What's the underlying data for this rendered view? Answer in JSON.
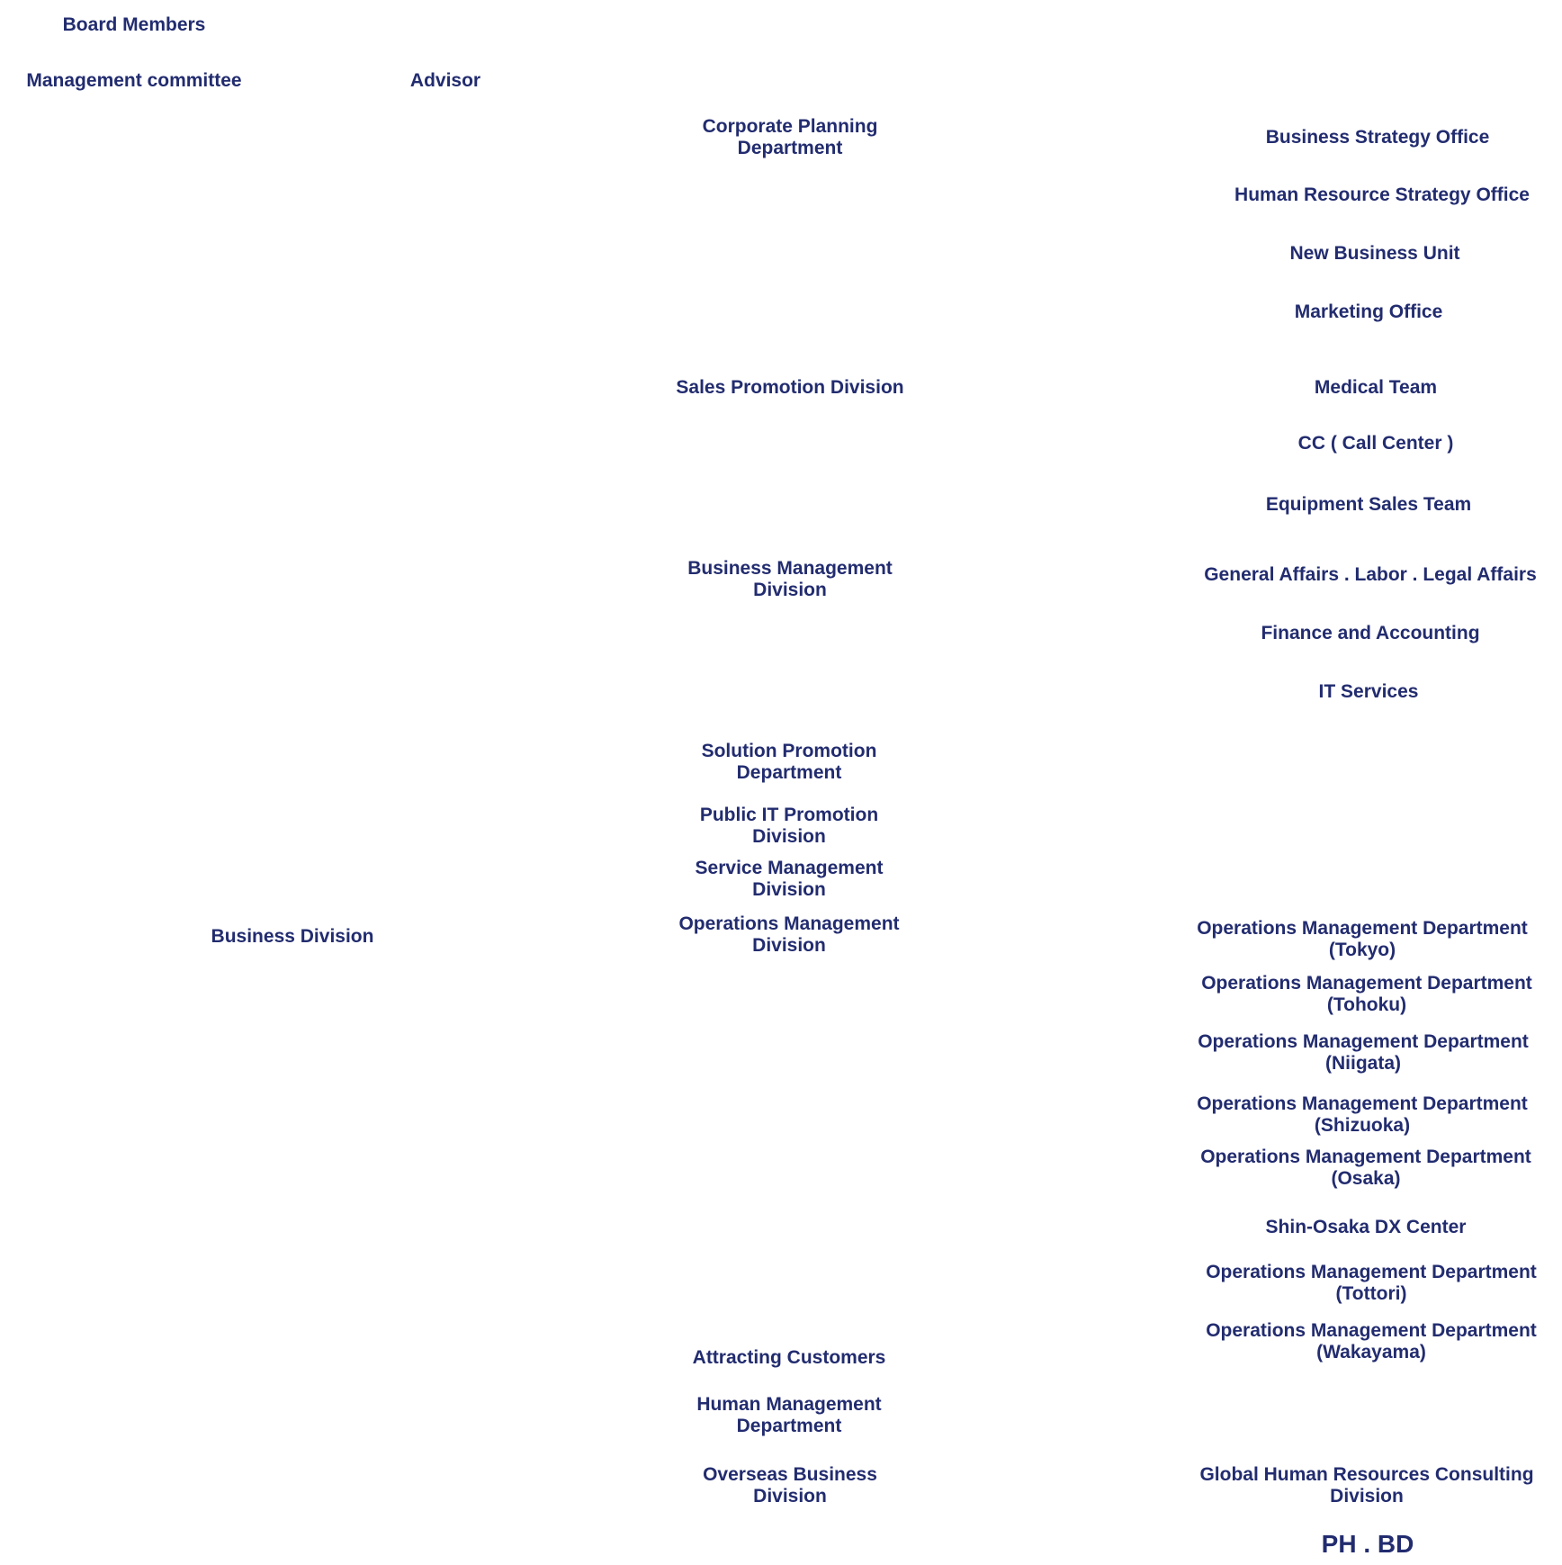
{
  "colors": {
    "text": "#222c6f",
    "background": "#ffffff"
  },
  "top": {
    "board_members": "Board Members",
    "management_committee": "Management committee",
    "advisor": "Advisor"
  },
  "business_division": "Business Division",
  "divisions": [
    {
      "label": "Corporate Planning\nDepartment"
    },
    {
      "label": "Sales Promotion Division"
    },
    {
      "label": "Business Management\nDivision"
    },
    {
      "label": "Solution Promotion\nDepartment"
    },
    {
      "label": "Public IT Promotion\nDivision"
    },
    {
      "label": "Service Management\nDivision"
    },
    {
      "label": "Operations Management\nDivision"
    },
    {
      "label": "Attracting Customers"
    },
    {
      "label": "Human Management\nDepartment"
    },
    {
      "label": "Overseas Business\nDivision"
    }
  ],
  "units": [
    {
      "label": "Business Strategy Office"
    },
    {
      "label": "Human Resource Strategy Office"
    },
    {
      "label": "New Business Unit"
    },
    {
      "label": "Marketing Office"
    },
    {
      "label": "Medical Team"
    },
    {
      "label": "CC ( Call Center )"
    },
    {
      "label": "Equipment Sales Team"
    },
    {
      "label": "General Affairs .  Labor .  Legal Affairs"
    },
    {
      "label": "Finance and Accounting"
    },
    {
      "label": "IT Services"
    },
    {
      "label": "Operations Management Department\n(Tokyo)"
    },
    {
      "label": "Operations Management Department\n(Tohoku)"
    },
    {
      "label": "Operations Management Department\n(Niigata)"
    },
    {
      "label": "Operations Management Department\n(Shizuoka)"
    },
    {
      "label": "Operations Management Department\n(Osaka)"
    },
    {
      "label": "Shin-Osaka DX Center"
    },
    {
      "label": "Operations Management Department\n(Tottori)"
    },
    {
      "label": "Operations Management Department\n(Wakayama)"
    },
    {
      "label": "Global Human Resources Consulting\nDivision"
    }
  ],
  "footer_label": "PH . BD"
}
